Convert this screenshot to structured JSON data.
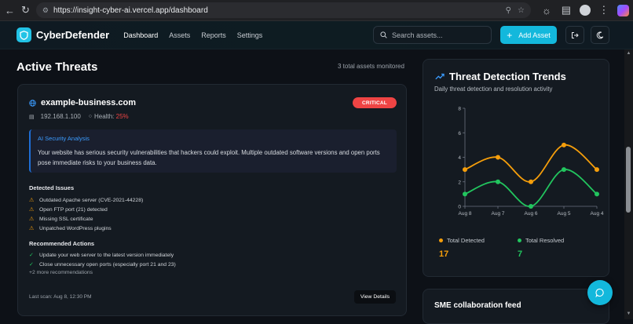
{
  "browser": {
    "url": "https://insight-cyber-ai.vercel.app/dashboard"
  },
  "navbar": {
    "brand": "CyberDefender",
    "links": [
      "Dashboard",
      "Assets",
      "Reports",
      "Settings"
    ],
    "search_placeholder": "Search assets...",
    "add_label": "Add Asset"
  },
  "threats": {
    "title": "Active Threats",
    "meta": "3 total assets monitored",
    "card": {
      "domain": "example-business.com",
      "severity": "CRITICAL",
      "ip": "192.168.1.100",
      "health_label": "Health:",
      "health_value": "25%",
      "ai_title": "AI Security Analysis",
      "ai_text": "Your website has serious security vulnerabilities that hackers could exploit. Multiple outdated software versions and open ports pose immediate risks to your business data.",
      "issues_title": "Detected Issues",
      "issues": [
        "Outdated Apache server (CVE-2021-44228)",
        "Open FTP port (21) detected",
        "Missing SSL certificate",
        "Unpatched WordPress plugins"
      ],
      "actions_title": "Recommended Actions",
      "actions": [
        "Update your web server to the latest version immediately",
        "Close unnecessary open ports (especially port 21 and 23)"
      ],
      "more": "+2 more recommendations",
      "last_scan": "Last scan: Aug 8, 12:30 PM",
      "view_label": "View Details"
    }
  },
  "trends": {
    "title": "Threat Detection Trends",
    "subtitle": "Daily threat detection and resolution activity",
    "legend": {
      "detected_label": "Total Detected",
      "detected_total": "17",
      "resolved_label": "Total Resolved",
      "resolved_total": "7"
    }
  },
  "feed": {
    "title": "SME collaboration feed"
  },
  "colors": {
    "accent": "#13b8dc",
    "critical": "#ef4444",
    "detected": "#f59e0b",
    "resolved": "#22c55e"
  },
  "chart_data": {
    "type": "line",
    "x": [
      "Aug 8",
      "Aug 7",
      "Aug 6",
      "Aug 5",
      "Aug 4"
    ],
    "ylim": [
      0,
      8
    ],
    "yticks": [
      0,
      2,
      4,
      6,
      8
    ],
    "series": [
      {
        "name": "Total Detected",
        "values": [
          3,
          4,
          2,
          5,
          3
        ],
        "color": "#f59e0b"
      },
      {
        "name": "Total Resolved",
        "values": [
          1,
          2,
          0,
          3,
          1
        ],
        "color": "#22c55e"
      }
    ]
  }
}
